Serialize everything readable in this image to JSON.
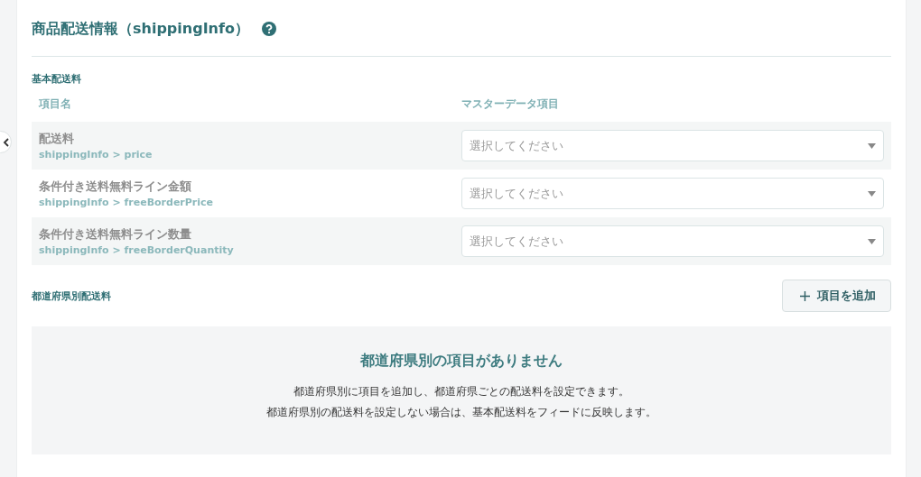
{
  "section": {
    "title": "商品配送情報（shippingInfo）"
  },
  "basic": {
    "heading": "基本配送料",
    "columns": [
      "項目名",
      "マスターデータ項目"
    ],
    "rows": [
      {
        "label": "配送料",
        "path": "shippingInfo > price",
        "placeholder": "選択してください"
      },
      {
        "label": "条件付き送料無料ライン金額",
        "path": "shippingInfo > freeBorderPrice",
        "placeholder": "選択してください"
      },
      {
        "label": "条件付き送料無料ライン数量",
        "path": "shippingInfo > freeBorderQuantity",
        "placeholder": "選択してください"
      }
    ]
  },
  "prefecture": {
    "heading": "都道府県別配送料",
    "add_button": "項目を追加",
    "empty_title": "都道府県別の項目がありません",
    "empty_lines": [
      "都道府県別に項目を追加し、都道府県ごとの配送料を設定できます。",
      "都道府県別の配送料を設定しない場合は、基本配送料をフィードに反映します。"
    ]
  }
}
